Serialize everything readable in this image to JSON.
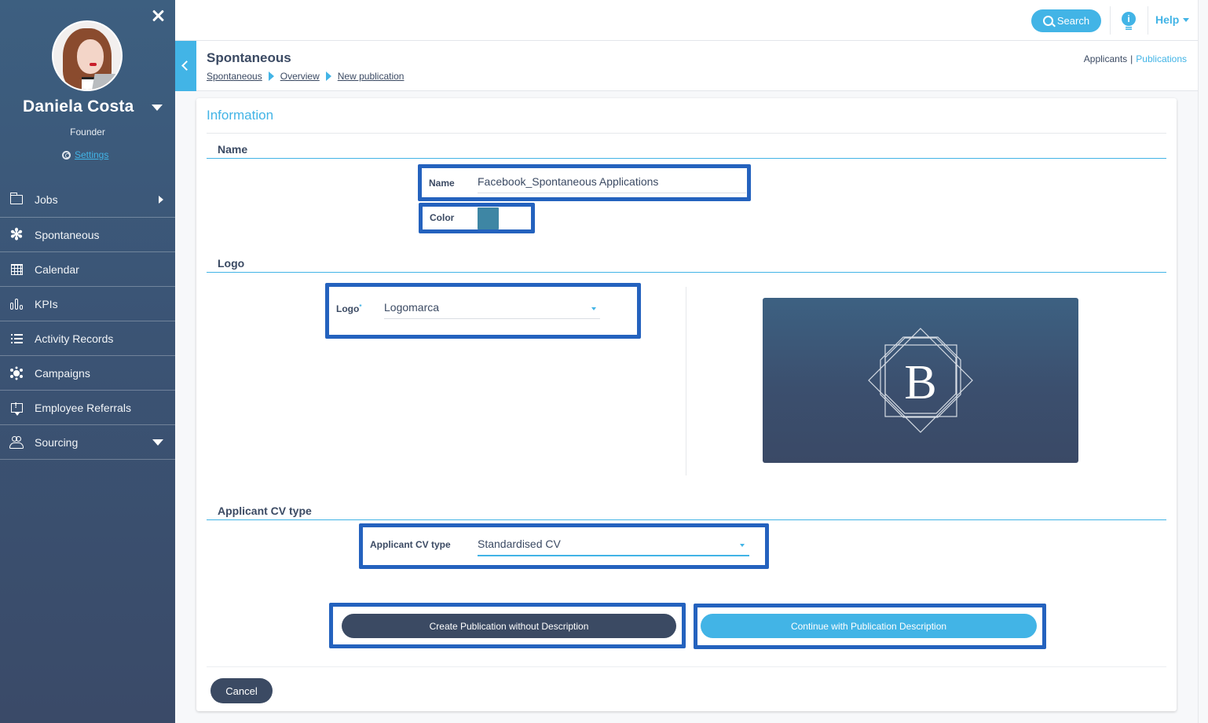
{
  "sidebar": {
    "user": {
      "name": "Daniela Costa",
      "role": "Founder",
      "settings_label": "Settings"
    },
    "items": [
      {
        "label": "Jobs",
        "icon": "folder-icon",
        "indicator": "chevron-right"
      },
      {
        "label": "Spontaneous",
        "icon": "asterisk-icon"
      },
      {
        "label": "Calendar",
        "icon": "calendar-icon"
      },
      {
        "label": "KPIs",
        "icon": "bar-chart-icon"
      },
      {
        "label": "Activity Records",
        "icon": "list-icon"
      },
      {
        "label": "Campaigns",
        "icon": "network-icon"
      },
      {
        "label": "Employee Referrals",
        "icon": "referral-icon"
      },
      {
        "label": "Sourcing",
        "icon": "people-icon",
        "indicator": "chevron-down"
      }
    ]
  },
  "topbar": {
    "search_label": "Search",
    "info_icon_glyph": "i",
    "help_label": "Help"
  },
  "subheader": {
    "title": "Spontaneous",
    "breadcrumb": [
      "Spontaneous",
      "Overview",
      "New publication"
    ],
    "tabs": {
      "applicants": "Applicants",
      "separator": "|",
      "publications": "Publications",
      "active": "Publications"
    }
  },
  "form": {
    "card_title": "Information",
    "sections": {
      "name": "Name",
      "logo": "Logo",
      "cv_type": "Applicant CV type"
    },
    "name_field": {
      "label": "Name",
      "value": "Facebook_Spontaneous Applications"
    },
    "color_field": {
      "label": "Color",
      "value": "#3e86a4"
    },
    "logo_field": {
      "label": "Logo",
      "required_mark": "*",
      "value": "Logomarca"
    },
    "logo_preview": {
      "letter": "B"
    },
    "cv_field": {
      "label": "Applicant CV type",
      "value": "Standardised CV"
    },
    "buttons": {
      "create_without": "Create Publication without Description",
      "continue_with": "Continue with Publication Description",
      "cancel": "Cancel"
    }
  },
  "colors": {
    "accent": "#42b4e6",
    "dark": "#3b4a63",
    "highlight_border": "#2462be",
    "sidebar": "#3b5576"
  }
}
